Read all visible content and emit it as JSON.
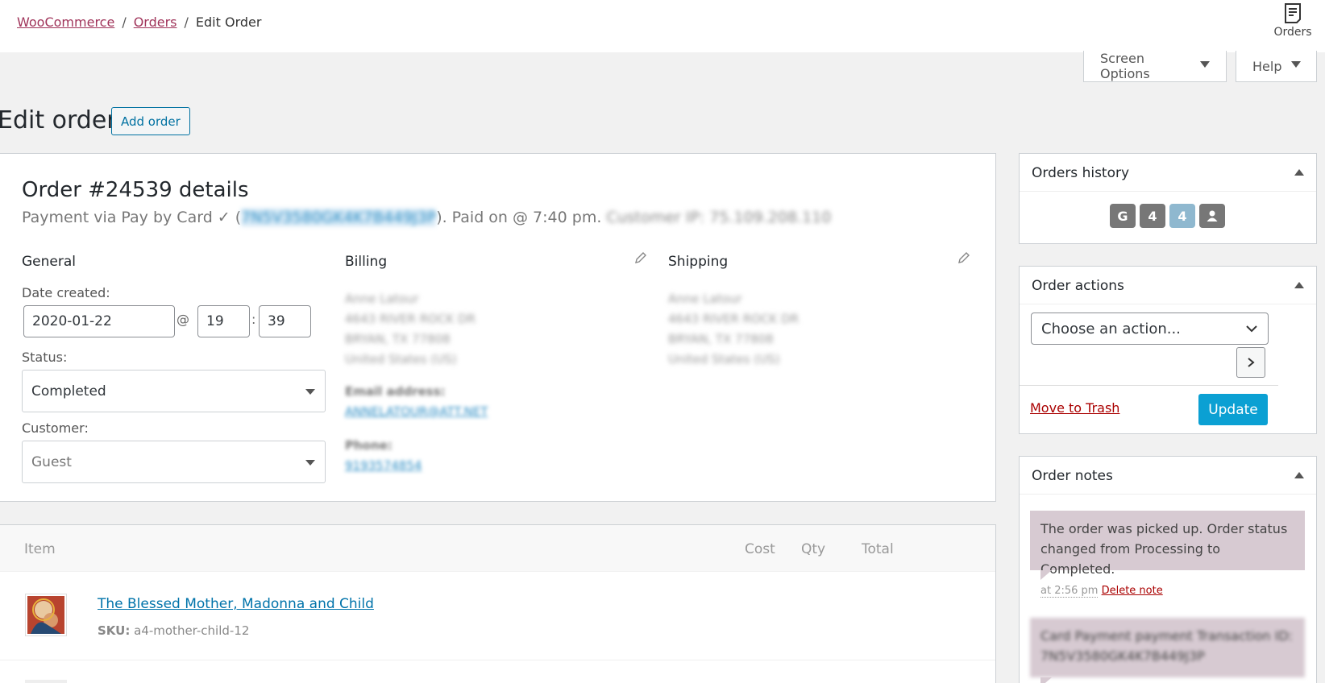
{
  "breadcrumb": {
    "root": "WooCommerce",
    "orders": "Orders",
    "current": "Edit Order",
    "sep": "/"
  },
  "top_right": {
    "label": "Orders",
    "icon": "orders-icon"
  },
  "screen_options": {
    "screen_label": "Screen Options",
    "help_label": "Help"
  },
  "heading": {
    "title": "Edit order",
    "add_button": "Add order"
  },
  "order": {
    "title": "Order #24539 details",
    "payment_prefix": "Payment via Pay by Card ✓ (",
    "transaction_id": "7N5V3580GK4K7B449J3P",
    "payment_suffix": "). Paid on @ 7:40 pm.",
    "customer_ip": "Customer IP: 75.109.208.110"
  },
  "general": {
    "heading": "General",
    "date_label": "Date created:",
    "date_value": "2020-01-22",
    "at_symbol": "@",
    "hour": "19",
    "colon": ":",
    "minute": "39",
    "status_label": "Status:",
    "status_value": "Completed",
    "customer_label": "Customer:",
    "customer_value": "Guest"
  },
  "billing": {
    "heading": "Billing",
    "address_lines": [
      "Anne Latour",
      "4643 RIVER ROCK DR",
      "BRYAN, TX 77808",
      "United States (US)"
    ],
    "email_label": "Email address:",
    "email_value": "ANNELATOUR@ATT.NET",
    "phone_label": "Phone:",
    "phone_value": "9193574854"
  },
  "shipping": {
    "heading": "Shipping",
    "address_lines": [
      "Anne Latour",
      "4643 RIVER ROCK DR",
      "BRYAN, TX 77808",
      "United States (US)"
    ]
  },
  "items": {
    "columns": {
      "item": "Item",
      "cost": "Cost",
      "qty": "Qty",
      "total": "Total"
    },
    "rows": [
      {
        "name": "The Blessed Mother, Madonna and Child",
        "sku_label": "SKU:",
        "sku": "a4-mother-child-12"
      }
    ]
  },
  "orders_history": {
    "title": "Orders history",
    "badges": [
      {
        "text": "G",
        "color": "#777777"
      },
      {
        "text": "4",
        "color": "#777777"
      },
      {
        "text": "4",
        "color": "#8fb8cf"
      },
      {
        "text": "●",
        "color": "#777777"
      }
    ]
  },
  "order_actions": {
    "title": "Order actions",
    "select_value": "Choose an action...",
    "trash_link": "Move to Trash",
    "update_button": "Update"
  },
  "order_notes": {
    "title": "Order notes",
    "notes": [
      {
        "text": "The order was picked up. Order status changed from Processing to Completed.",
        "time": "at 2:56 pm",
        "delete": "Delete note"
      },
      {
        "text": "Card Payment payment Transaction ID: 7N5V3580GK4K7B449J3P"
      }
    ]
  },
  "colors": {
    "link": "#0073aa",
    "breadcrumb_link": "#a0345a",
    "update": "#0ba0d3",
    "note_bg": "#d7cad2",
    "trash": "#aa0000"
  }
}
